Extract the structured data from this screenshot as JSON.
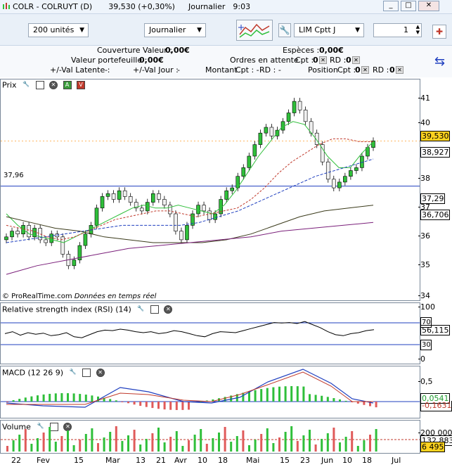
{
  "window": {
    "title": "COLR - COLRUYT (D)",
    "quote": "39,530 (+0,30%)",
    "period_title": "Journalier",
    "time": "9:03",
    "minimize": "_",
    "maximize": "□",
    "close": "✕"
  },
  "toolbar": {
    "units_value": "200 unités",
    "period_value": "Journalier",
    "order_type_value": "LIM Cptt J",
    "quantity_value": "1"
  },
  "account": {
    "couverture_label": "Couverture Valeur :",
    "couverture_value": "0,00€",
    "especes_label": "Espèces :",
    "especes_value": "0,00€",
    "valeur_label": "Valeur portefeuille :",
    "valeur_value": "0,00€",
    "ordres_label": "Ordres en attente",
    "cpt_label": "Cpt :",
    "cpt_value": "0",
    "rd_label": "RD :",
    "rd_value": "0",
    "latente_label": "+/-Val Latente :",
    "latente_value": "-",
    "jour_label": "+/-Val Jour :",
    "jour_value": "-",
    "montant_label": "Montant",
    "montant_cpt": "Cpt : -",
    "montant_rd": "RD : -",
    "position_label": "Position",
    "position_cpt_label": "Cpt :",
    "position_cpt_value": "0",
    "position_rd_label": "RD :",
    "position_rd_value": "0"
  },
  "panels": {
    "price": {
      "title": "Prix",
      "ref_line_label": "37,96",
      "y_ticks": [
        "41",
        "40",
        "38",
        "37",
        "36",
        "35",
        "34"
      ],
      "boxes": [
        {
          "label": "39,530",
          "bg": "#ffd21f"
        },
        {
          "label": "38,927",
          "bg": "#ffffff"
        },
        {
          "label": "37,29",
          "bg": "#ffffff"
        },
        {
          "label": "36,706",
          "bg": "#ffffff"
        }
      ],
      "credit": "© ProRealTime.com",
      "credit_sub": "Données en temps réel"
    },
    "rsi": {
      "title": "Relative strength index (RSI) (14)",
      "y_ticks": [
        "100",
        "0"
      ],
      "boxes": [
        "70",
        "56,115",
        "30"
      ]
    },
    "macd": {
      "title": "MACD (12 26 9)",
      "y_ticks": [
        "0,5"
      ],
      "boxes": [
        {
          "label": "0,0541",
          "bg": "#ffffff",
          "color": "#1e9b2e"
        },
        {
          "label": "-0,1631",
          "bg": "#ffffff",
          "color": "#c0392b"
        }
      ]
    },
    "volume": {
      "title": "Volume",
      "y_ticks": [
        "200 000"
      ],
      "boxes": [
        {
          "label": "132 883",
          "bg": "#ffffff"
        },
        {
          "label": "6 495",
          "bg": "#ffd21f"
        }
      ]
    }
  },
  "x_axis": [
    "22",
    "Fev",
    "15",
    "Mar",
    "13",
    "21",
    "Avr",
    "10",
    "18",
    "Mai",
    "15",
    "23",
    "Jun",
    "10",
    "18",
    "Jul"
  ],
  "colors": {
    "up_candle": "#2fbf3a",
    "down_candle": "#f0f0f0",
    "ma_short": "#2fbf3a",
    "ma_mid": "#c0392b",
    "ma_blue": "#1f3fbf",
    "ma_long": "#3a3a1a",
    "ma_purple": "#7a1f7a"
  }
}
